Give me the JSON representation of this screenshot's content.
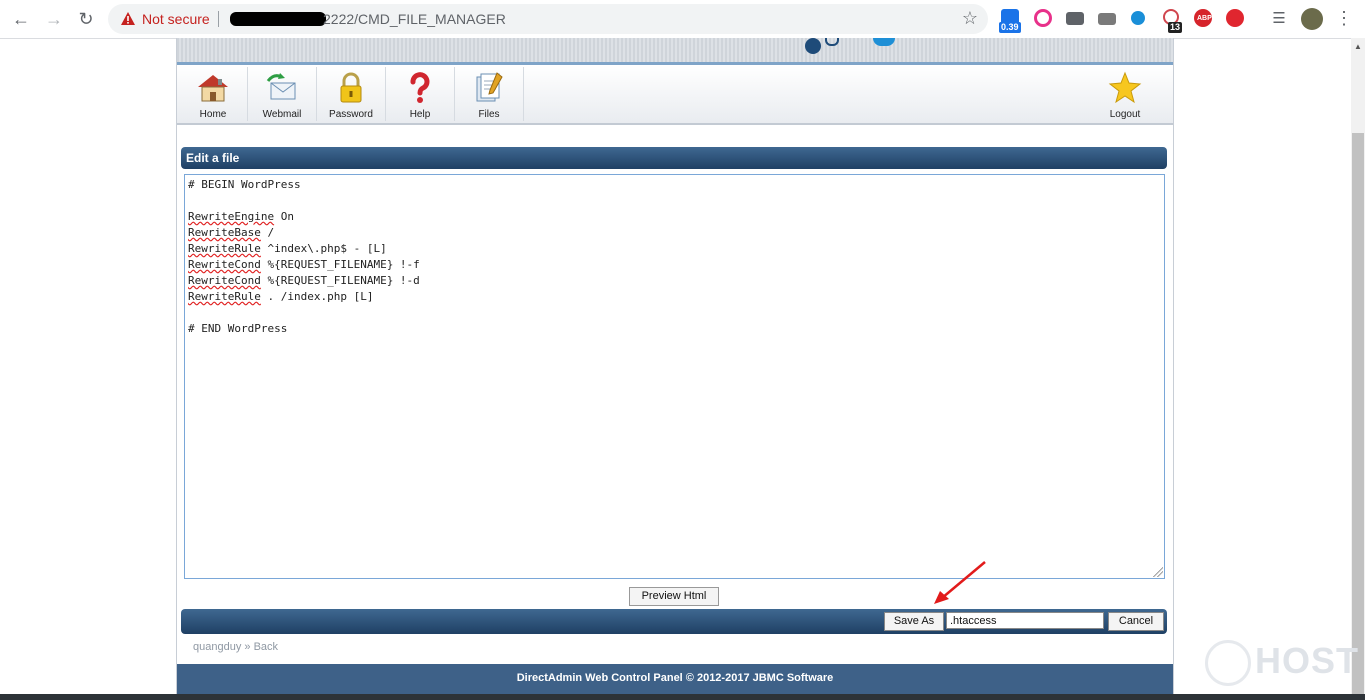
{
  "browser": {
    "security_label": "Not secure",
    "url": "2222/CMD_FILE_MANAGER",
    "ext_badges": [
      "0.39",
      "13",
      "ABP"
    ]
  },
  "toolbar": {
    "items": [
      {
        "label": "Home",
        "icon": "home-icon"
      },
      {
        "label": "Webmail",
        "icon": "webmail-icon"
      },
      {
        "label": "Password",
        "icon": "lock-icon"
      },
      {
        "label": "Help",
        "icon": "question-icon"
      },
      {
        "label": "Files",
        "icon": "files-icon"
      }
    ],
    "logout_label": "Logout"
  },
  "editor": {
    "title": "Edit a file",
    "lines": [
      "# BEGIN WordPress",
      "",
      "RewriteEngine On",
      "RewriteBase /",
      "RewriteRule ^index\\.php$ - [L]",
      "RewriteCond %{REQUEST_FILENAME} !-f",
      "RewriteCond %{REQUEST_FILENAME} !-d",
      "RewriteRule . /index.php [L]",
      "",
      "# END WordPress"
    ],
    "preview_label": "Preview Html"
  },
  "save": {
    "save_as_label": "Save As",
    "filename": ".htaccess",
    "cancel_label": "Cancel"
  },
  "breadcrumb": {
    "user": "quangduy",
    "separator": "»",
    "back": "Back"
  },
  "footer": {
    "text": "DirectAdmin Web Control Panel © 2012-2017 JBMC Software"
  },
  "watermark": "HOST",
  "colors": {
    "accent_bar": "#2b507a",
    "warning": "#c5221f",
    "annotation_arrow": "#e21b1b"
  }
}
